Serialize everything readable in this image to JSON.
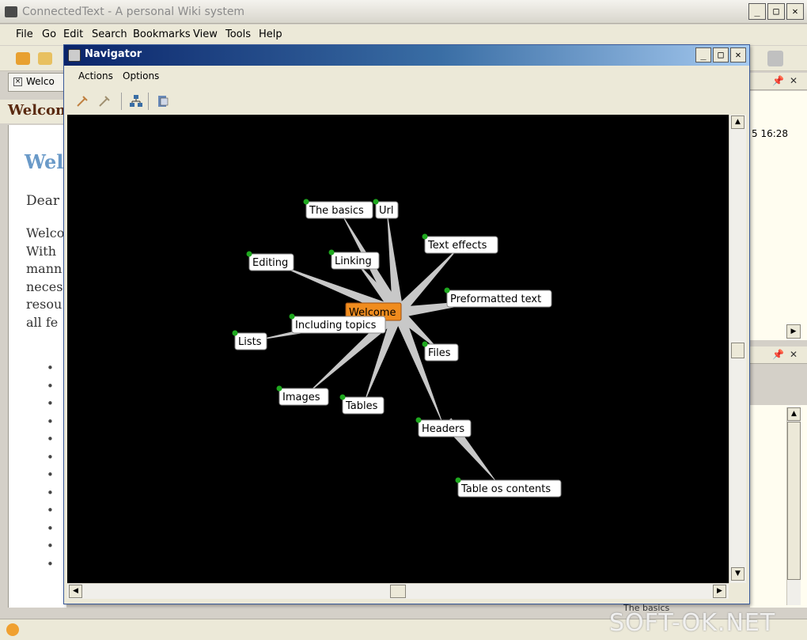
{
  "main": {
    "title": "ConnectedText - A personal Wiki system",
    "menu": [
      "File",
      "Go",
      "Edit",
      "Search",
      "Bookmarks",
      "View",
      "Tools",
      "Help"
    ],
    "doc_tab": "Welco",
    "heading": "Welcon",
    "body": {
      "heading": "Wel",
      "dear": "Dear",
      "para_lines": [
        "Welco",
        "With",
        "mann",
        "neces",
        "resou",
        "all fe"
      ]
    },
    "right_time": "5 16:28",
    "status_item": "The basics",
    "watermark": "SOFT-OK.NET"
  },
  "navigator": {
    "title": "Navigator",
    "menu": [
      "Actions",
      "Options"
    ],
    "center": "Welcome",
    "nodes": [
      "The basics",
      "Url",
      "Text effects",
      "Editing",
      "Linking",
      "Preformatted text",
      "Including topics",
      "Lists",
      "Files",
      "Images",
      "Tables",
      "Headers",
      "Table os contents"
    ]
  },
  "colors": {
    "graph_bg": "#000000",
    "center_node": "#f08c1e",
    "node_bg": "#ffffff",
    "edge": "#c8c8c8",
    "node_marker": "#1fa81f",
    "nav_title_start": "#0a246a",
    "nav_title_end": "#a6caf0"
  }
}
